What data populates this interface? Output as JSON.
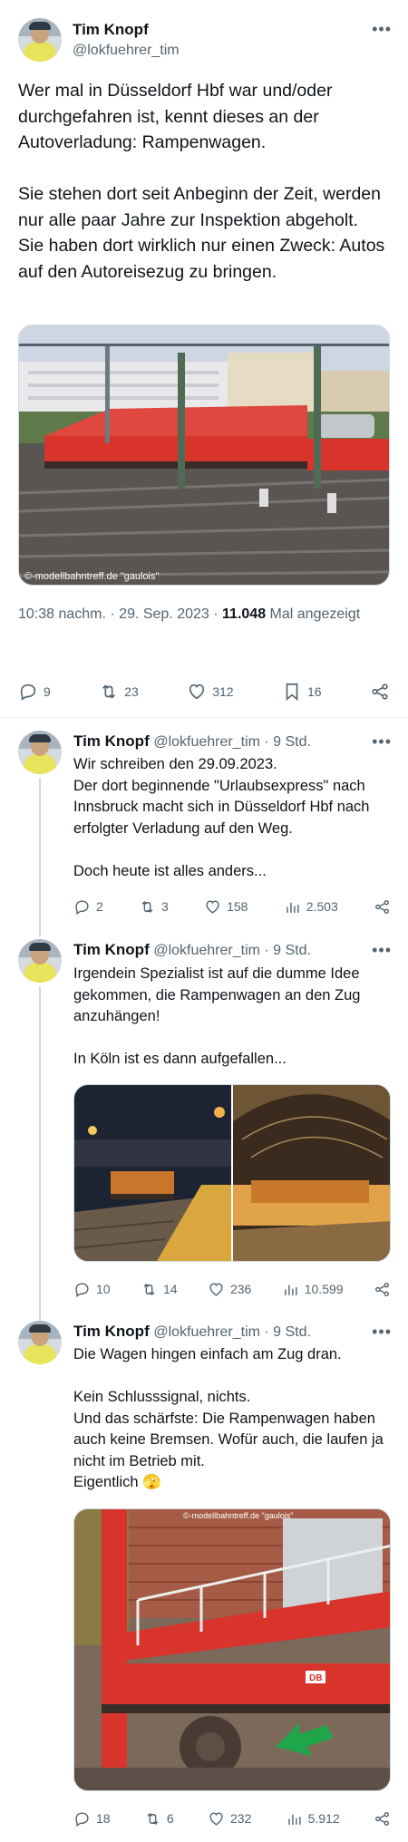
{
  "main": {
    "name": "Tim Knopf",
    "handle": "@lokfuehrer_tim",
    "text": "Wer mal in Düsseldorf Hbf war und/oder durchgefahren ist, kennt dieses an der Autoverladung: Rampenwagen.\n\nSie stehen dort seit Anbeginn der Zeit, werden nur alle paar Jahre zur Inspektion abgeholt.\nSie haben dort wirklich nur einen Zweck: Autos auf den Autoreisezug zu bringen.",
    "watermark": "©-modellbahntreff.de \"gaulois\"",
    "time": "10:38 nachm. · 29. Sep. 2023 · ",
    "views_count": "11.048",
    "views_label": " Mal angezeigt",
    "replies": "9",
    "retweets": "23",
    "likes": "312",
    "bookmarks": "16"
  },
  "replies": [
    {
      "name": "Tim Knopf",
      "handle": "@lokfuehrer_tim · 9 Std.",
      "text": "Wir schreiben den 29.09.2023.\nDer dort beginnende \"Urlaubsexpress\" nach Innsbruck macht sich in Düsseldorf Hbf nach erfolgter Verladung auf den Weg.\n\nDoch heute ist alles anders...",
      "replies": "2",
      "retweets": "3",
      "likes": "158",
      "views": "2.503"
    },
    {
      "name": "Tim Knopf",
      "handle": "@lokfuehrer_tim · 9 Std.",
      "text": "Irgendein Spezialist ist auf die dumme Idee gekommen, die Rampenwagen an den Zug anzuhängen!\n\nIn Köln ist es dann aufgefallen...",
      "replies": "10",
      "retweets": "14",
      "likes": "236",
      "views": "10.599"
    },
    {
      "name": "Tim Knopf",
      "handle": "@lokfuehrer_tim · 9 Std.",
      "text": "Die Wagen hingen einfach am Zug dran.\n\nKein Schlusssignal, nichts.\nUnd das schärfste: Die Rampenwagen haben auch keine Bremsen. Wofür auch, die laufen ja nicht im Betrieb mit.\nEigentlich 🫣",
      "watermark": "©-modellbahntreff.de \"gaulois\"",
      "replies": "18",
      "retweets": "6",
      "likes": "232",
      "views": "5.912"
    }
  ],
  "icons": {
    "more": "more-dots-icon",
    "reply": "reply-icon",
    "retweet": "retweet-icon",
    "like": "heart-icon",
    "bookmark": "bookmark-icon",
    "share": "share-icon",
    "views": "views-icon"
  },
  "colors": {
    "text": "#0f1419",
    "secondary": "#536471",
    "divider": "#eff3f4",
    "wagon_red": "#d8342c",
    "arrow_green": "#1fa64a"
  }
}
